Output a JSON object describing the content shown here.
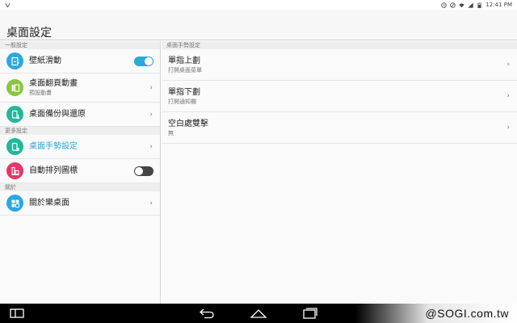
{
  "status_bar": {
    "time": "12:41",
    "time_suffix": "PM",
    "icons": [
      "notification-icon",
      "alarm-icon",
      "mute-icon",
      "wifi-icon",
      "signal-icon",
      "battery-icon"
    ]
  },
  "header": {
    "title": "桌面設定"
  },
  "left_pane": {
    "sections": [
      {
        "header": "一般設定",
        "items": [
          {
            "label": "壁紙滑動",
            "subtitle": "",
            "control": "toggle",
            "toggle_on": true,
            "icon": "wallpaper-icon",
            "icon_color": "#29a9e1"
          },
          {
            "label": "桌面翻頁動畫",
            "subtitle": "預設動畫",
            "control": "chevron",
            "icon": "page-transition-icon",
            "icon_color": "#8cc63f"
          },
          {
            "label": "桌面備份與還原",
            "subtitle": "",
            "control": "chevron",
            "icon": "backup-icon",
            "icon_color": "#1fb89a"
          }
        ]
      },
      {
        "header": "更多設定",
        "items": [
          {
            "label": "桌面手勢設定",
            "subtitle": "",
            "control": "chevron",
            "active": true,
            "icon": "gesture-icon",
            "icon_color": "#1fb89a"
          },
          {
            "label": "自動排列圖標",
            "subtitle": "",
            "control": "toggle",
            "toggle_on": false,
            "icon": "auto-arrange-icon",
            "icon_color": "#e8356b"
          }
        ]
      },
      {
        "header": "關於",
        "items": [
          {
            "label": "關於樂桌面",
            "subtitle": "",
            "control": "chevron",
            "icon": "about-icon",
            "icon_color": "#2aa8e0"
          }
        ]
      }
    ]
  },
  "right_pane": {
    "header": "桌面手勢設定",
    "items": [
      {
        "label": "單指上劃",
        "subtitle": "打開桌面菜單"
      },
      {
        "label": "單指下劃",
        "subtitle": "打開通知欄"
      },
      {
        "label": "空白處雙擊",
        "subtitle": "無"
      }
    ]
  },
  "chevron_glyph": "›",
  "nav_bar": {
    "icons": [
      "split-screen-icon",
      "back-icon",
      "home-icon",
      "recent-apps-icon"
    ]
  },
  "watermark": "@SOGI.com.tw"
}
